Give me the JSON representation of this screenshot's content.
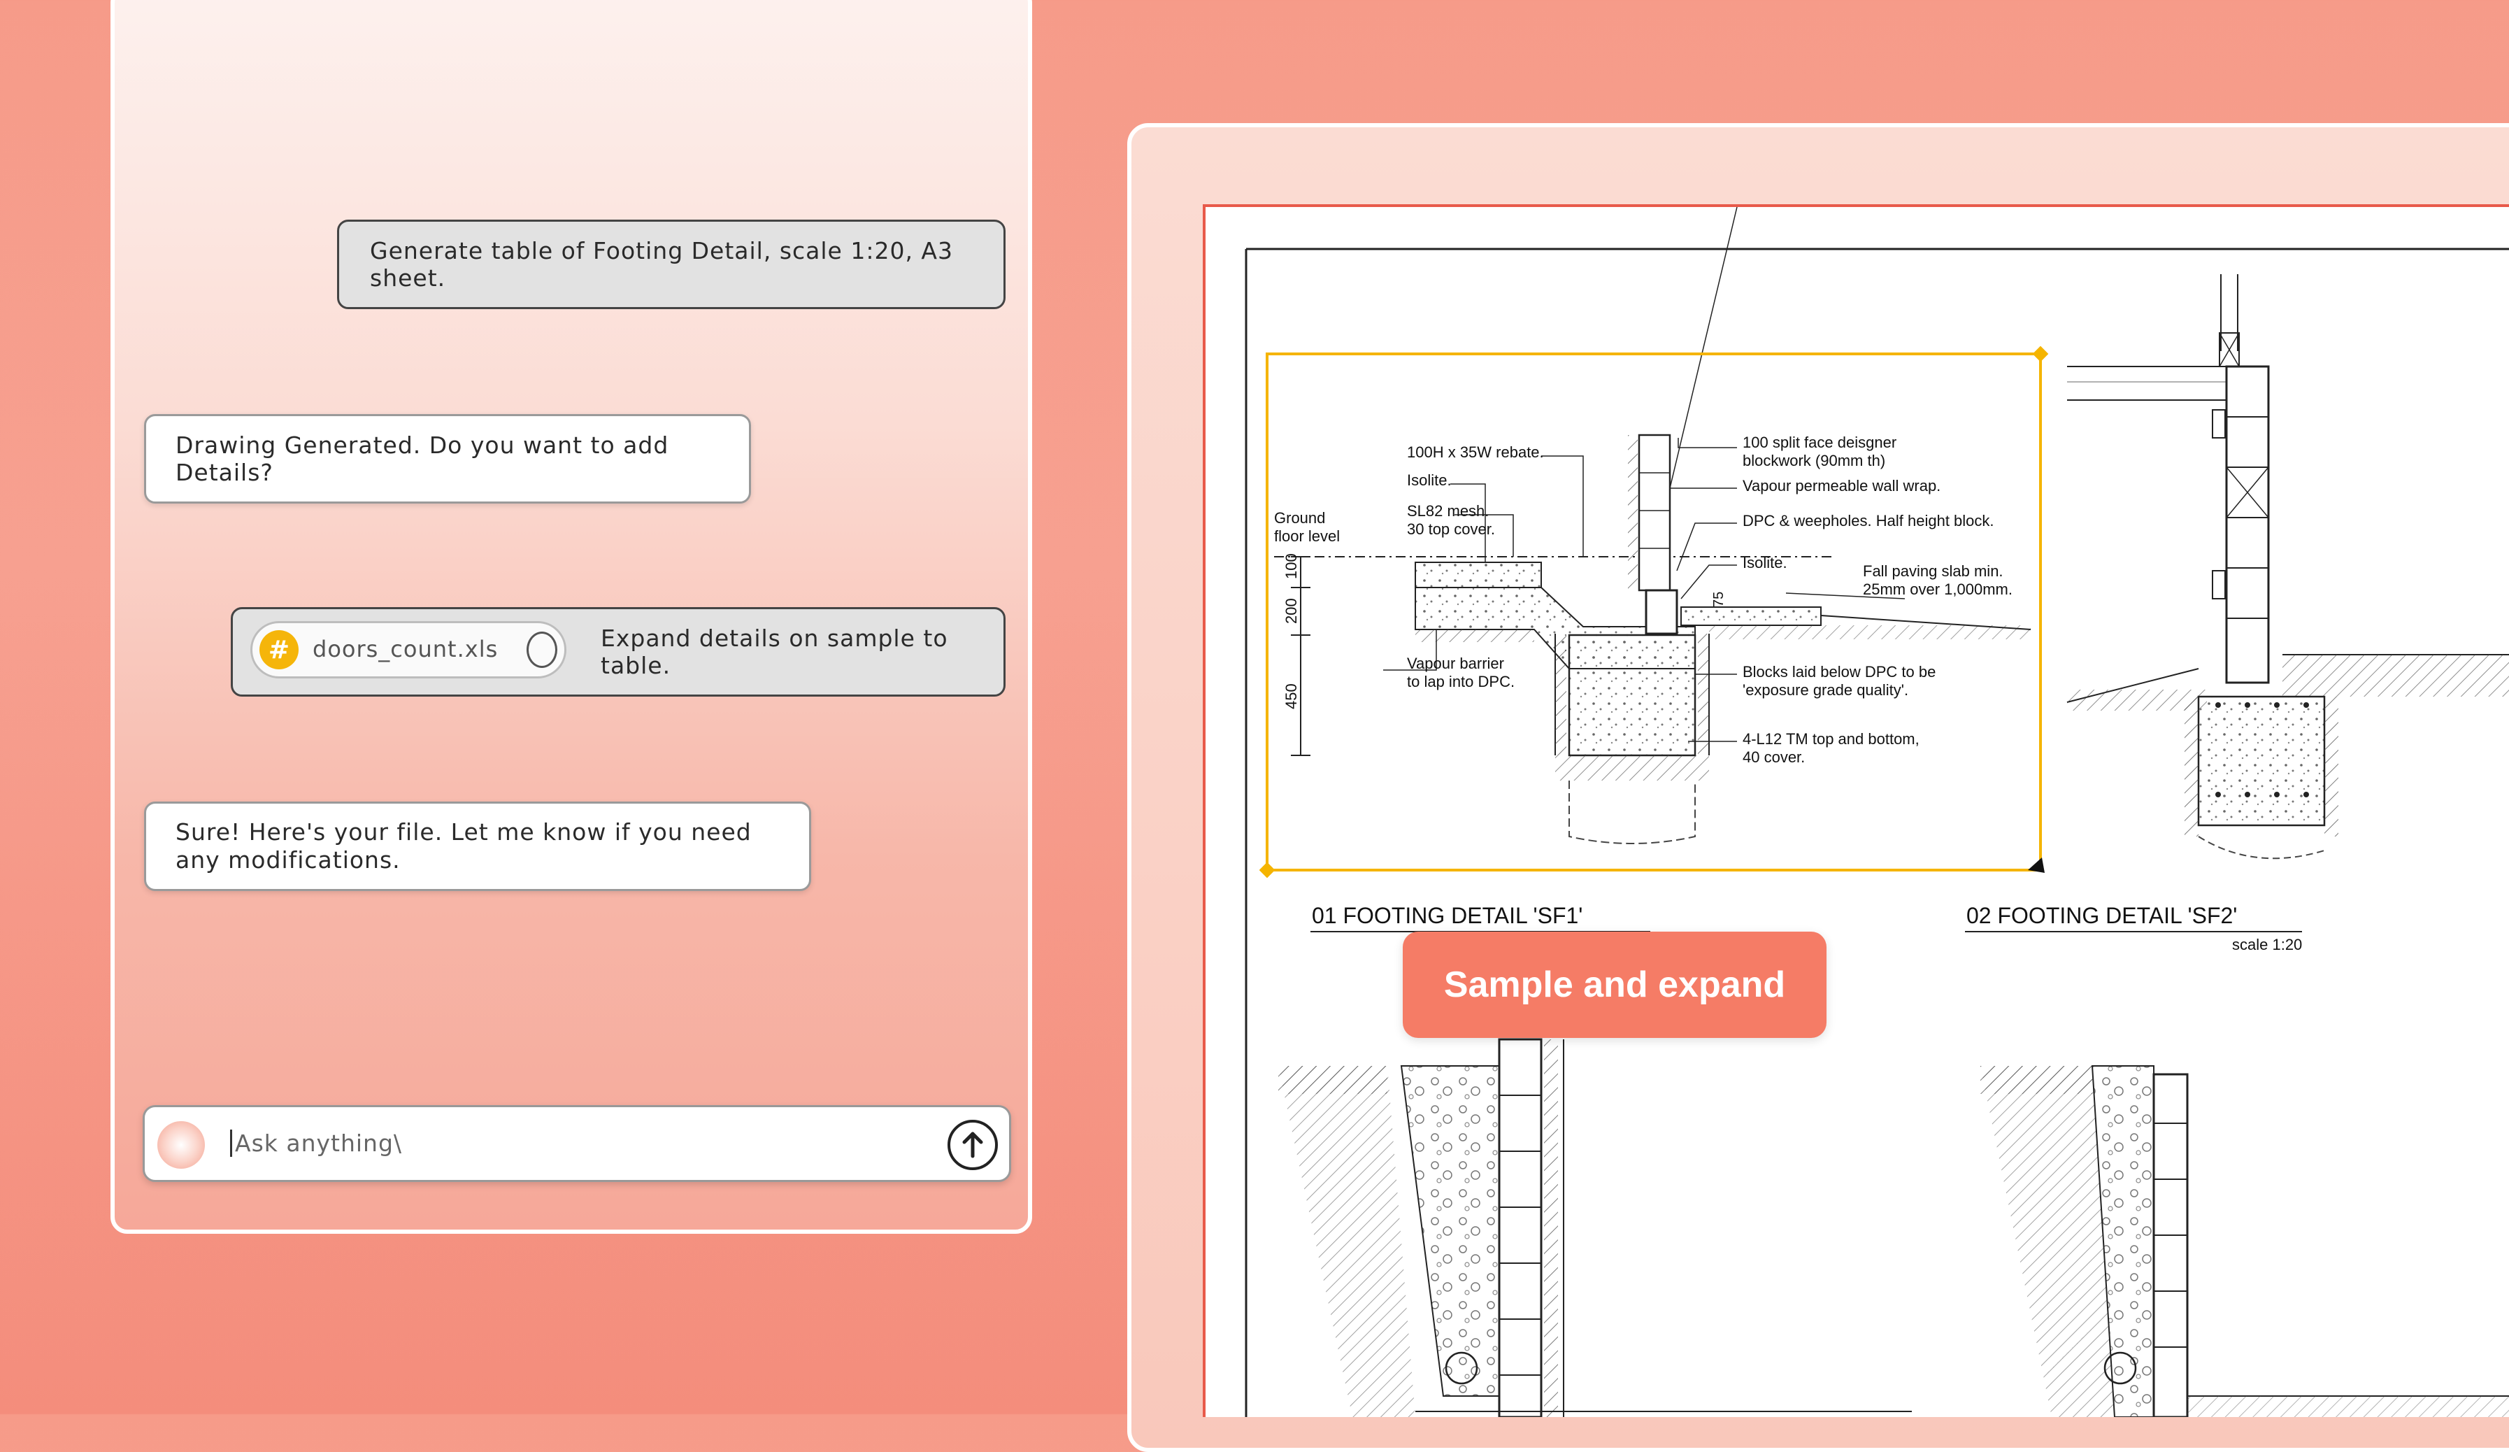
{
  "chat": {
    "messages": [
      {
        "role": "user",
        "text": "Generate table of Footing Detail, scale 1:20, A3 sheet."
      },
      {
        "role": "assistant",
        "text": "Drawing Generated. Do you want to add Details?"
      },
      {
        "role": "user",
        "text": "Expand details on sample to table.",
        "attachment": {
          "file_name": "doors_count.xls",
          "icon": "hash-icon"
        }
      },
      {
        "role": "assistant",
        "text": "Sure! Here's your file. Let me know if you need any modifications."
      }
    ],
    "input": {
      "placeholder": "Ask anything\\"
    }
  },
  "drawing": {
    "cta_label": "Sample and expand",
    "details": [
      {
        "title": "01 FOOTING DETAIL 'SF1'"
      },
      {
        "title": "02 FOOTING DETAIL 'SF2'",
        "scale": "scale 1:20"
      }
    ],
    "annotations": {
      "rebate": "100H x 35W rebate.",
      "isolite_top": "Isolite.",
      "mesh": "SL82 mesh.",
      "mesh_cover": "30 top cover.",
      "ground_1": "Ground",
      "ground_2": "floor level",
      "dim_100": "100",
      "dim_200": "200",
      "dim_450": "450",
      "dim_75": "75",
      "vapour_1": "Vapour barrier",
      "vapour_2": "to lap into DPC.",
      "blockwork_1": "100 split face deisgner",
      "blockwork_2": "blockwork (90mm th)",
      "wrap": "Vapour permeable wall wrap.",
      "dpc": "DPC & weepholes.  Half height block.",
      "isolite_right": "Isolite.",
      "paving_1": "Fall paving slab min.",
      "paving_2": "25mm over 1,000mm.",
      "blocks_1": "Blocks laid below DPC to be",
      "blocks_2": "'exposure grade quality'.",
      "bars_1": "4-L12 TM top and bottom,",
      "bars_2": "40 cover."
    },
    "colors": {
      "selection": "#f5b400",
      "accent": "#f57c66",
      "sheet_border": "#e85a4a"
    }
  }
}
